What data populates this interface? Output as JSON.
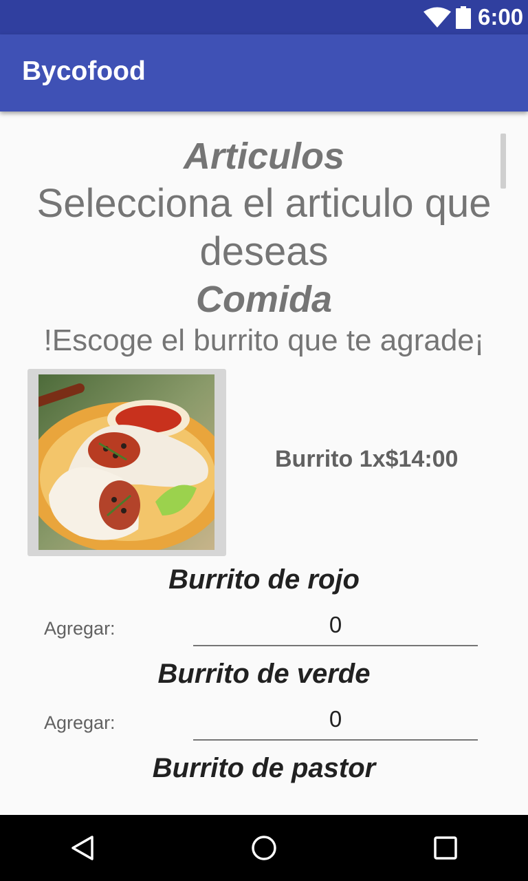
{
  "status_bar": {
    "time": "6:00"
  },
  "app_bar": {
    "title": "Bycofood"
  },
  "content": {
    "heading": "Articulos",
    "subtitle_line1": "Selecciona el articulo que",
    "subtitle_line2": "deseas",
    "category": "Comida",
    "prompt": "!Escoge el burrito que te agrade¡",
    "product": {
      "price_text": "Burrito 1x$14:00"
    },
    "items": [
      {
        "name": "Burrito de rojo",
        "add_label": "Agregar:",
        "quantity": "0"
      },
      {
        "name": "Burrito de verde",
        "add_label": "Agregar:",
        "quantity": "0"
      },
      {
        "name": "Burrito de pastor"
      }
    ]
  },
  "icons": {
    "status": [
      "wifi-icon",
      "battery-icon"
    ],
    "nav": [
      "back-icon",
      "home-icon",
      "recents-icon"
    ]
  }
}
